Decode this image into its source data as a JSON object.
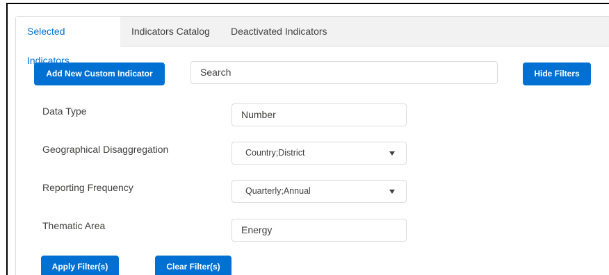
{
  "tabs": [
    {
      "label": "Selected Indicators",
      "active": true
    },
    {
      "label": "Indicators Catalog",
      "active": false
    },
    {
      "label": "Deactivated Indicators",
      "active": false
    }
  ],
  "toolbar": {
    "add_label": "Add New Custom Indicator",
    "search_placeholder": "Search",
    "hide_filters_label": "Hide Filters"
  },
  "filters": {
    "data_type": {
      "label": "Data Type",
      "value": "Number"
    },
    "geo": {
      "label": "Geographical Disaggregation",
      "value": "Country;District"
    },
    "freq": {
      "label": "Reporting Frequency",
      "value": "Quarterly;Annual"
    },
    "thematic": {
      "label": "Thematic Area",
      "value": "Energy"
    }
  },
  "actions": {
    "apply_label": "Apply Filter(s)",
    "clear_label": "Clear Filter(s)"
  },
  "colors": {
    "accent": "#0070d2",
    "tabbar_bg": "#f3f2f2",
    "border": "#dddbda"
  }
}
